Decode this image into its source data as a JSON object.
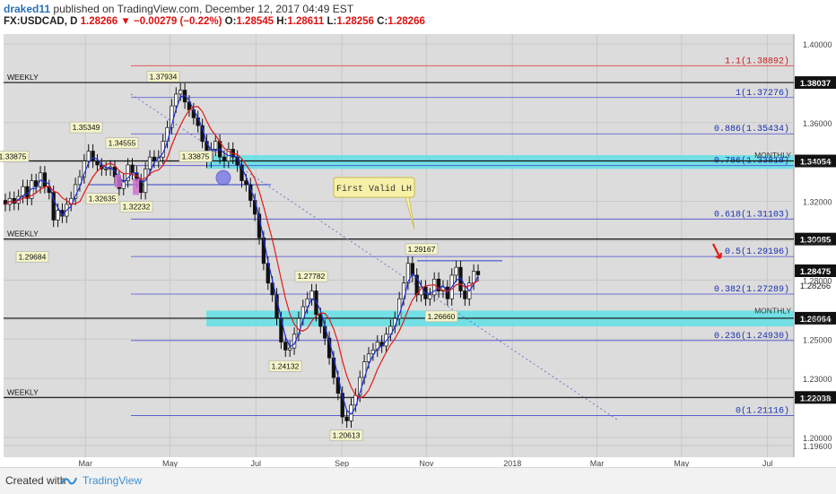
{
  "header": {
    "username": "draked11",
    "published_text": "published on TradingView.com, December 12, 2017 04:49 EST",
    "symbol": "FX:USDCAD, D",
    "last_price": "1.28266",
    "change": "−0.00279 (−0.22%)",
    "open_label": "O:",
    "open": "1.28545",
    "high_label": "H:",
    "high": "1.28611",
    "low_label": "L:",
    "low": "1.28256",
    "close_label": "C:",
    "close": "1.28266"
  },
  "footer": {
    "created_with": "Created with",
    "brand": "TradingView"
  },
  "colors": {
    "candle": "#111111",
    "ma_fast": "#1e2fd6",
    "ma_slow": "#e01b1b",
    "zone": "#5fe0e6",
    "fib": "#4b4bd0",
    "fib_top": "#e04848"
  },
  "chart_data": {
    "type": "candlestick",
    "ylim": [
      1.19,
      1.405
    ],
    "y_ticks": [
      "1.40000",
      "1.36000",
      "1.34000",
      "1.32000",
      "1.30000",
      "1.28000",
      "1.26000",
      "1.25000",
      "1.23000",
      "1.22000",
      "1.20000",
      "1.19600"
    ],
    "x_ticks": [
      {
        "label": "Mar",
        "x": 59
      },
      {
        "label": "May",
        "x": 120
      },
      {
        "label": "Jul",
        "x": 182
      },
      {
        "label": "Sep",
        "x": 244
      },
      {
        "label": "Nov",
        "x": 305
      },
      {
        "label": "2018",
        "x": 367
      },
      {
        "label": "Mar",
        "x": 428
      },
      {
        "label": "May",
        "x": 489
      },
      {
        "label": "Jul",
        "x": 551
      }
    ],
    "candles_close": [
      1.3185,
      1.3215,
      1.319,
      1.3225,
      1.3275,
      1.3215,
      1.3305,
      1.3275,
      1.3345,
      1.3275,
      1.3245,
      1.3105,
      1.3155,
      1.3125,
      1.3185,
      1.3215,
      1.3285,
      1.3325,
      1.3405,
      1.3455,
      1.3405,
      1.3385,
      1.3365,
      1.3365,
      1.3375,
      1.3325,
      1.3265,
      1.3305,
      1.3385,
      1.3345,
      1.3305,
      1.3245,
      1.3365,
      1.3425,
      1.3405,
      1.3425,
      1.3505,
      1.3575,
      1.3685,
      1.3745,
      1.3765,
      1.3705,
      1.3665,
      1.3625,
      1.3585,
      1.3505,
      1.3405,
      1.3465,
      1.3505,
      1.3425,
      1.3405,
      1.3465,
      1.3425,
      1.3385,
      1.3305,
      1.3285,
      1.3205,
      1.3135,
      1.3015,
      1.2885,
      1.2785,
      1.2725,
      1.2605,
      1.2485,
      1.2445,
      1.2455,
      1.2525,
      1.2605,
      1.2665,
      1.2705,
      1.2745,
      1.2625,
      1.2565,
      1.2505,
      1.2405,
      1.2305,
      1.2225,
      1.2105,
      1.2085,
      1.2165,
      1.2215,
      1.2305,
      1.2385,
      1.2425,
      1.2445,
      1.2485,
      1.2465,
      1.2525,
      1.2565,
      1.2605,
      1.2705,
      1.2785,
      1.2885,
      1.2825,
      1.2725,
      1.2765,
      1.2705,
      1.2725,
      1.2805,
      1.2745,
      1.2765,
      1.2705,
      1.2825,
      1.2865,
      1.2745,
      1.2705,
      1.2785,
      1.2845,
      1.2827
    ],
    "levels": [
      {
        "label": "1.1(1.38892)",
        "value": 1.38892,
        "kind": "fib"
      },
      {
        "label": "1(1.37276)",
        "value": 1.37276,
        "kind": "fib"
      },
      {
        "label": "0.886(1.35434)",
        "value": 1.35434,
        "kind": "fib"
      },
      {
        "label": "0.786(1.33818)",
        "value": 1.33818,
        "kind": "fib"
      },
      {
        "label": "0.618(1.31103)",
        "value": 1.31103,
        "kind": "fib"
      },
      {
        "label": "0.5(1.29196)",
        "value": 1.29196,
        "kind": "fib"
      },
      {
        "label": "0.382(1.27289)",
        "value": 1.27289,
        "kind": "fib"
      },
      {
        "label": "0.236(1.24930)",
        "value": 1.2493,
        "kind": "fib"
      },
      {
        "label": "0(1.21116)",
        "value": 1.21116,
        "kind": "fib"
      }
    ],
    "horizontal_lines": [
      {
        "label": "WEEKLY",
        "price": "1.38037",
        "value": 1.38037
      },
      {
        "label": "MONTHLY",
        "price": "1.34054",
        "value": 1.34054
      },
      {
        "label": "WEEKLY",
        "price": "1.30085",
        "value": 1.30085
      },
      {
        "label": "MONTHLY",
        "price": "1.26064",
        "value": 1.26064
      },
      {
        "label": "WEEKLY",
        "price": "1.22038",
        "value": 1.22038
      }
    ],
    "current_price": {
      "label": "1.28475",
      "value": 1.28475
    },
    "last_label": "1.28266",
    "zones": [
      {
        "label": "MONTHLY",
        "top": 1.3435,
        "bottom": 1.3365
      },
      {
        "label": "MONTHLY",
        "top": 1.2645,
        "bottom": 1.2565
      }
    ],
    "annotations": [
      {
        "text": "1.37934",
        "value": 1.37934
      },
      {
        "text": "1.35349",
        "value": 1.35349
      },
      {
        "text": "1.34555",
        "value": 1.34555
      },
      {
        "text": "1.33875",
        "value": 1.33875
      },
      {
        "text": "1.33875",
        "value": 1.33875
      },
      {
        "text": "1.32635",
        "value": 1.32635
      },
      {
        "text": "1.32232",
        "value": 1.32232
      },
      {
        "text": "1.29684",
        "value": 1.29684
      },
      {
        "text": "1.27782",
        "value": 1.27782
      },
      {
        "text": "1.24132",
        "value": 1.24132
      },
      {
        "text": "1.20613",
        "value": 1.20613
      },
      {
        "text": "1.29167",
        "value": 1.29167
      },
      {
        "text": "1.26660",
        "value": 1.2666
      }
    ],
    "callout": "First Valid LH"
  }
}
